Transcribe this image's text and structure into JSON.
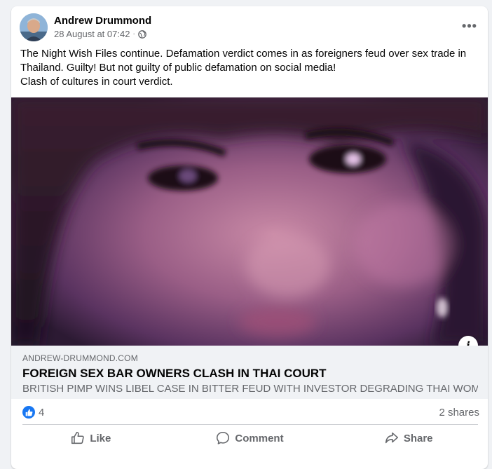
{
  "post": {
    "author": "Andrew Drummond",
    "timestamp": "28 August at 07:42",
    "privacy_icon": "globe-icon",
    "more_label": "•••",
    "text_lines": [
      "The Night Wish Files continue. Defamation verdict comes in as foreigners feud over sex trade in",
      "Thailand. Guilty! But not guilty of public defamation on social media!",
      "Clash of cultures in court verdict."
    ]
  },
  "link": {
    "domain": "ANDREW-DRUMMOND.COM",
    "title": "FOREIGN SEX BAR OWNERS CLASH IN THAI COURT",
    "description": "BRITISH PIMP WINS LIBEL CASE IN BITTER FEUD WITH INVESTOR DEGRADING THAI WOMEN ...",
    "info_icon": "info-icon",
    "info_label": "i"
  },
  "stats": {
    "reaction_icon": "like-icon",
    "reaction_count": "4",
    "shares": "2 shares"
  },
  "actions": {
    "like": "Like",
    "comment": "Comment",
    "share": "Share"
  },
  "colors": {
    "accent": "#1877f2",
    "secondary_text": "#65676b",
    "preview_bg": "#f0f2f5"
  }
}
